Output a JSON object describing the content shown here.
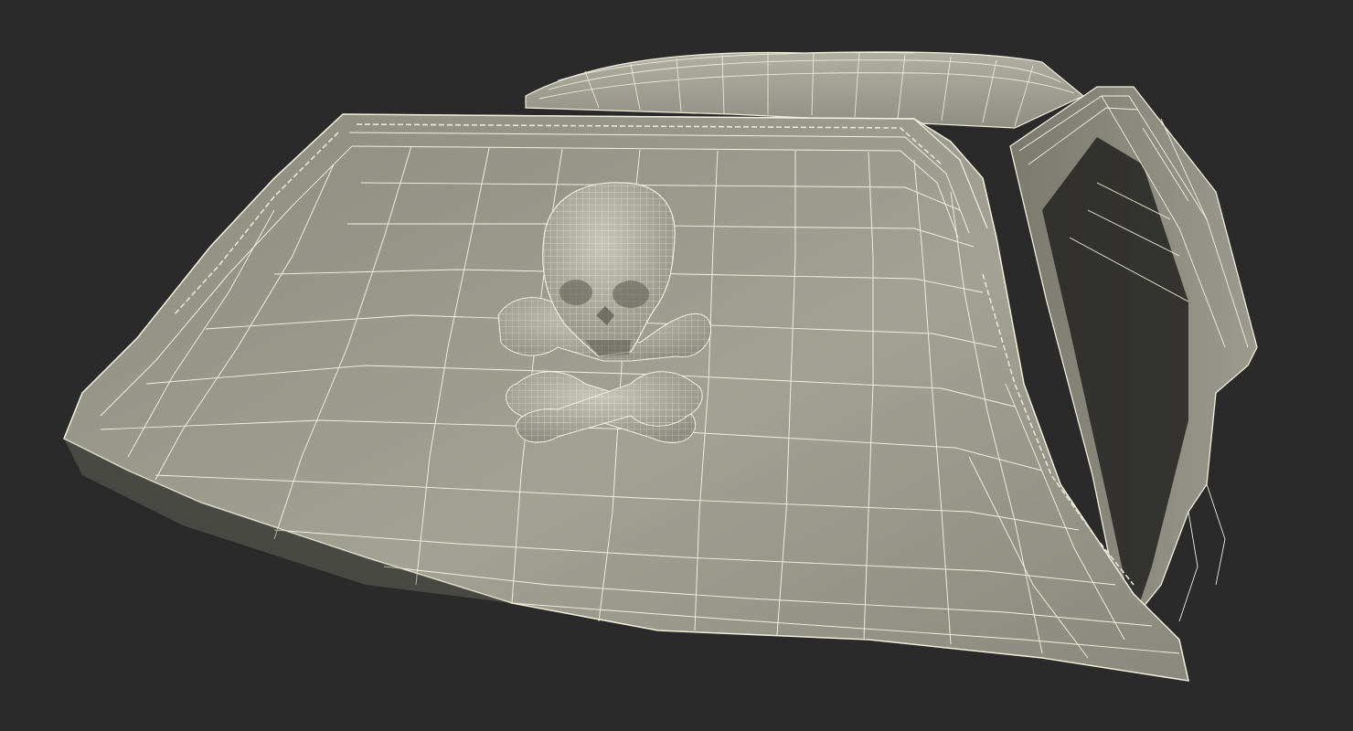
{
  "scene": {
    "subject": "pirate-tricorn-hat-wireframe-render",
    "colors": {
      "background": "#2a2a2a",
      "surface": "#8e8c7f",
      "surface_light": "#a6a497",
      "surface_dark": "#6a695f",
      "wire": "#f1efdc",
      "interior": "#1e1e1c"
    },
    "emblem": "skull-and-crossbones"
  }
}
